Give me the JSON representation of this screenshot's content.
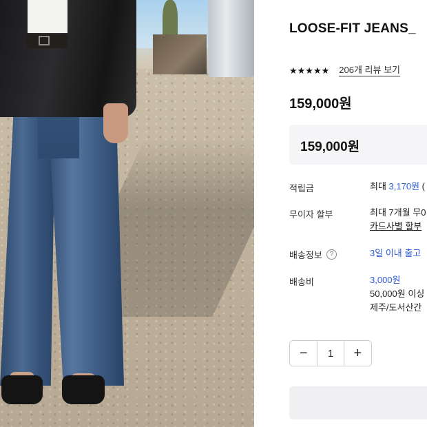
{
  "product": {
    "title": "LOOSE-FIT JEANS_",
    "stars": "★★★★★",
    "review_link": "206개 리뷰 보기",
    "price": "159,000원",
    "box_price": "159,000원"
  },
  "details": {
    "points": {
      "label": "적립금",
      "prefix": "최대 ",
      "amount": "3,170원",
      "suffix": " ("
    },
    "installment": {
      "label": "무이자 할부",
      "line1": "최대 7개월 무0",
      "line2": "카드사별 할부"
    },
    "shipping_info": {
      "label": "배송정보",
      "value": "3일 이내 출고"
    },
    "shipping_fee": {
      "label": "배송비",
      "amount": "3,000원",
      "line2": "50,000원 이싱",
      "line3": "제주/도서산간"
    }
  },
  "quantity": {
    "minus": "−",
    "value": "1",
    "plus": "+"
  },
  "icons": {
    "help": "question-circle-icon"
  },
  "colors": {
    "accent_blue": "#2f5bd3"
  }
}
